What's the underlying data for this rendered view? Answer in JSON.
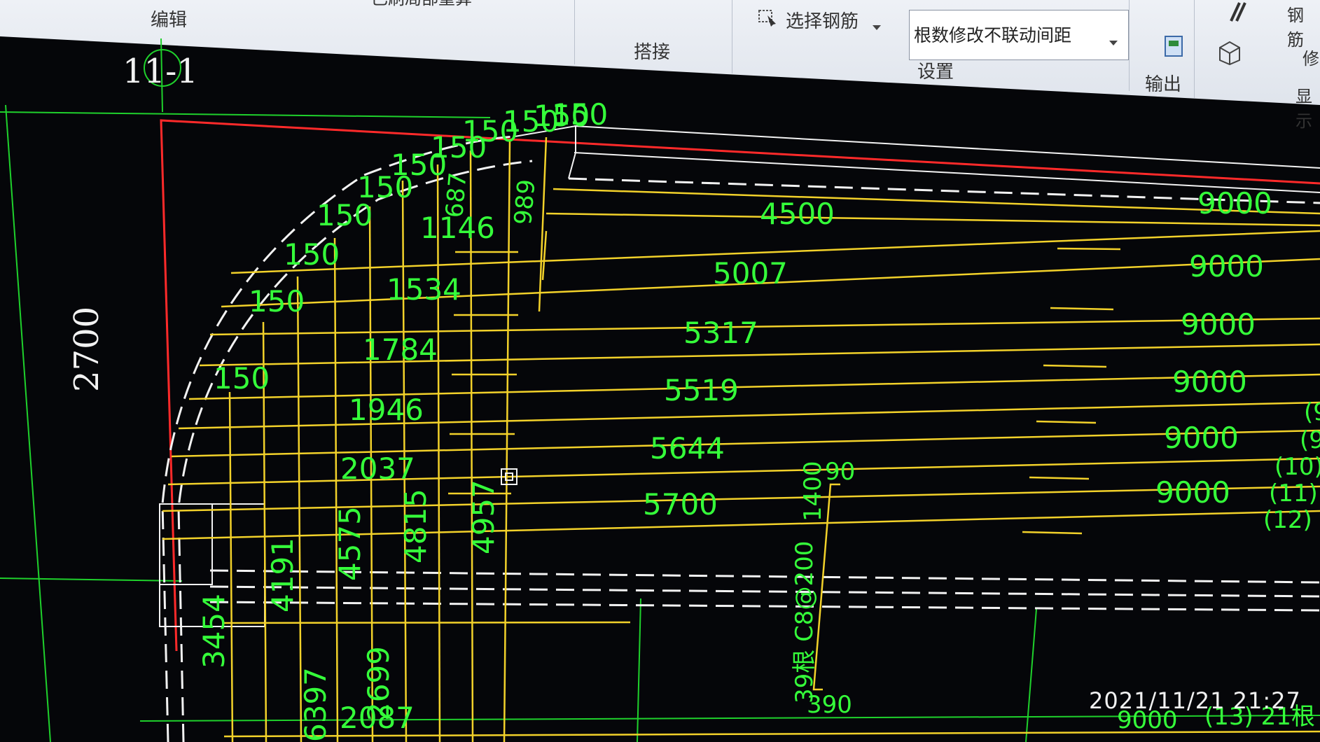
{
  "ribbon": {
    "edit_label": "编辑",
    "partial_calc_label": "已刷局部重算",
    "lap_label": "搭接",
    "select_rebar_label": "选择钢筋",
    "count_mode_value": "根数修改不联动间距",
    "settings_label": "设置",
    "output_label": "输出",
    "rebar_label": "钢筋",
    "display_label": "显示",
    "modify_label": "修"
  },
  "drawing": {
    "section_title": "11-1",
    "height_dim": "2700",
    "arc_spacing": [
      "150",
      "150",
      "150",
      "150",
      "150",
      "150",
      "150",
      "150",
      "150",
      "150",
      "150"
    ],
    "small_dims": [
      "687",
      "989"
    ],
    "vertical_lengths": [
      "1146",
      "1534",
      "1784",
      "1946",
      "2037"
    ],
    "horizontal_lengths": [
      "4500",
      "5007",
      "5317",
      "5519",
      "5644",
      "5700"
    ],
    "right_lengths": [
      "9000",
      "9000",
      "9000",
      "9000",
      "9000",
      "9000"
    ],
    "vertical_bottom_labels": [
      "3454",
      "4191",
      "4575",
      "4815",
      "4957"
    ],
    "bottom_labels": [
      "6397",
      "2699",
      "2087"
    ],
    "stirrup_label": "1400",
    "hook_label": "90",
    "rebar_spec": "39根 C8@200",
    "hook_bottom": "390",
    "right_marks": [
      "(9",
      "(9",
      "(10)",
      "(11)",
      "(12)"
    ],
    "bottom_right_length": "9000",
    "bottom_right_mark": "(13) 21根"
  },
  "timestamp": "2021/11/21 21:27",
  "colors": {
    "background": "#050609",
    "rebar": "#f2d12a",
    "text": "#35ff3a",
    "outline": "#ff2a2a",
    "dashed": "#f2f2f2",
    "axis": "#1fd12c"
  },
  "icons": [
    "select-rebar-icon",
    "dropdown-arrow-icon",
    "output-icon",
    "box-3d-icon",
    "rebar-tool-icon"
  ]
}
